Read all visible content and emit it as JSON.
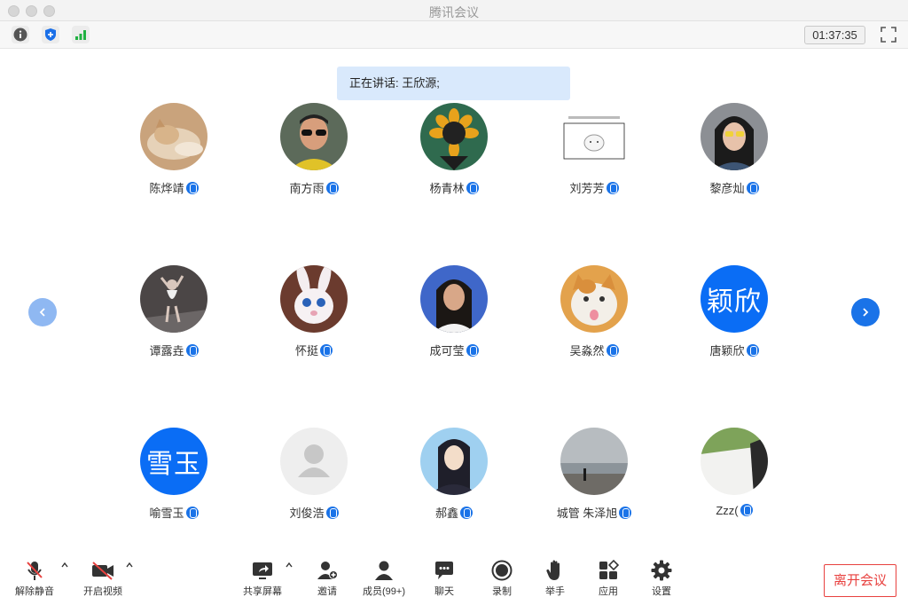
{
  "window": {
    "title": "腾讯会议"
  },
  "status": {
    "timer": "01:37:35"
  },
  "speaking": {
    "text": "正在讲话: 王欣源;"
  },
  "participants": [
    {
      "name": "陈烨靖",
      "avatar": "photo-cat"
    },
    {
      "name": "南方雨",
      "avatar": "photo-man-sunglasses"
    },
    {
      "name": "杨青林",
      "avatar": "photo-sunflower-cat"
    },
    {
      "name": "刘芳芳",
      "avatar": "photo-meme"
    },
    {
      "name": "黎彦灿",
      "avatar": "photo-girl"
    },
    {
      "name": "谭露垚",
      "avatar": "photo-dancer"
    },
    {
      "name": "怀挺",
      "avatar": "photo-rabbit"
    },
    {
      "name": "成可莹",
      "avatar": "photo-woman"
    },
    {
      "name": "吴淼然",
      "avatar": "photo-cat-tongue"
    },
    {
      "name": "唐颖欣",
      "avatar_text": "颖欣"
    },
    {
      "name": "喻雪玉",
      "avatar_text": "雪玉"
    },
    {
      "name": "刘俊浩",
      "avatar": "default-person"
    },
    {
      "name": "郝鑫",
      "avatar": "photo-anime"
    },
    {
      "name": "城管 朱泽旭",
      "avatar": "photo-beach"
    },
    {
      "name": "Zzz(",
      "avatar": "photo-plant"
    }
  ],
  "toolbar": {
    "unmute": "解除静音",
    "start_video": "开启视频",
    "share_screen": "共享屏幕",
    "invite": "邀请",
    "members": "成员(99+)",
    "chat": "聊天",
    "record": "录制",
    "raise_hand": "举手",
    "apps": "应用",
    "settings": "设置",
    "leave": "离开会议"
  },
  "colors": {
    "accent": "#0a6df5",
    "leave": "#e8413f",
    "banner": "#d9e9fc"
  }
}
